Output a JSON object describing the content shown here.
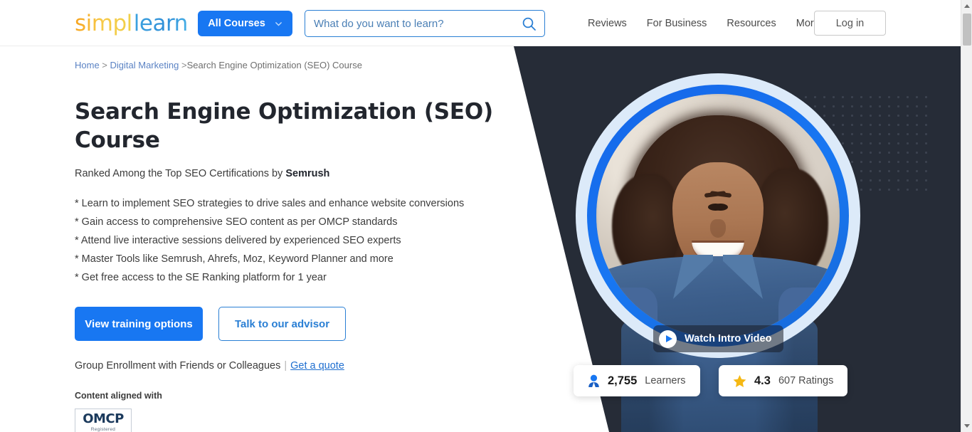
{
  "header": {
    "logo": {
      "part_a": "simpl",
      "part_b": "learn",
      "alt": "simplilearn"
    },
    "all_courses_label": "All Courses",
    "search": {
      "placeholder": "What do you want to learn?",
      "value": ""
    },
    "nav": [
      {
        "label": "Reviews"
      },
      {
        "label": "For Business"
      },
      {
        "label": "Resources"
      }
    ],
    "more_label": "More",
    "login_label": "Log in"
  },
  "breadcrumb": {
    "home": "Home",
    "sep1": " > ",
    "category": "Digital Marketing",
    "sep2": " >",
    "current": "Search Engine Optimization (SEO) Course"
  },
  "main": {
    "title": "Search Engine Optimization (SEO) Course",
    "subtitle_prefix": "Ranked Among the Top SEO Certifications by ",
    "subtitle_brand": "Semrush",
    "bullets": [
      "* Learn to implement SEO strategies to drive sales and enhance website conversions",
      "* Gain access to comprehensive SEO content as per OMCP standards",
      "* Attend live interactive sessions delivered by experienced SEO experts",
      "* Master Tools like Semrush, Ahrefs, Moz, Keyword Planner and more",
      "* Get free access to the SE Ranking platform for 1 year"
    ],
    "primary_cta": "View training options",
    "secondary_cta": "Talk to our advisor",
    "group_text": "Group Enrollment with Friends or Colleagues",
    "group_divider": "|",
    "group_link": "Get a quote",
    "aligned_label": "Content aligned with",
    "omcp": {
      "mark": "OMCP",
      "sub": "Registered"
    }
  },
  "hero": {
    "watch_label": "Watch Intro Video",
    "learners": {
      "value": "2,755",
      "label": "Learners"
    },
    "ratings": {
      "value": "4.3",
      "label": "607 Ratings"
    }
  },
  "colors": {
    "brand_blue": "#1877f2",
    "link_blue": "#2a7fd4",
    "hero_dark": "#262c37",
    "logo_orange": "#f5a623",
    "star_yellow": "#f5b814"
  }
}
